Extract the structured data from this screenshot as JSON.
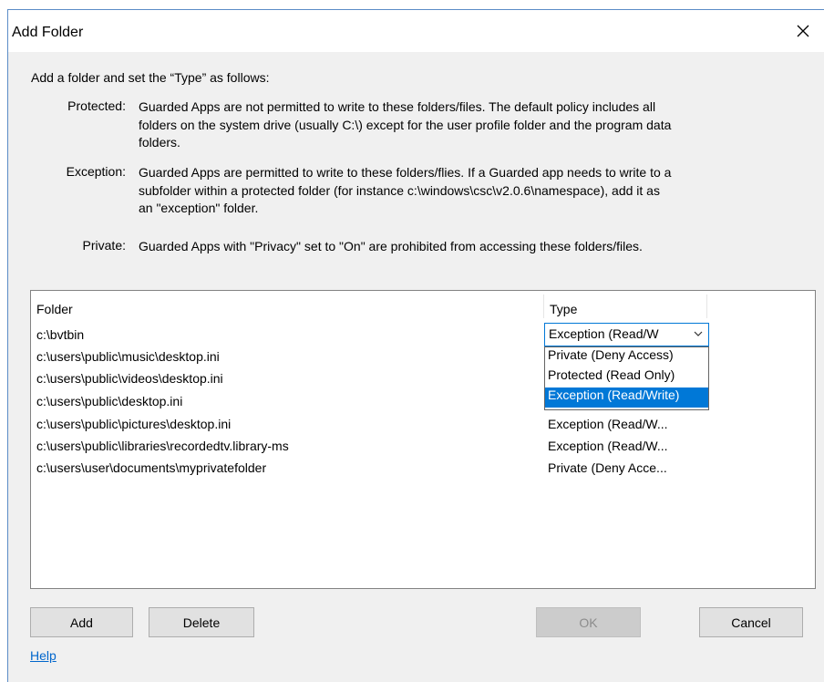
{
  "window": {
    "title": "Add Folder"
  },
  "intro": "Add a folder and set the “Type” as follows:",
  "definitions": [
    {
      "term": "Protected:",
      "lines": [
        "Guarded Apps are not permitted to write to these folders/files. The default policy includes all",
        "folders on the system drive (usually C:\\) except for the user profile folder and the program data",
        "folders."
      ]
    },
    {
      "term": "Exception:",
      "lines": [
        "Guarded Apps are permitted to write to these folders/flies. If a Guarded app needs to write to a",
        "subfolder within a protected folder (for instance c:\\windows\\csc\\v2.0.6\\namespace), add it as",
        "an \"exception\" folder."
      ]
    },
    {
      "term": "Private:",
      "lines": [
        "Guarded Apps with \"Privacy\" set to \"On\" are prohibited from accessing these folders/files."
      ]
    }
  ],
  "table": {
    "columns": [
      "Folder",
      "Type"
    ],
    "rows": [
      {
        "folder": "c:\\bvtbin",
        "type": "Exception (Read/W"
      },
      {
        "folder": "c:\\users\\public\\music\\desktop.ini",
        "type": ""
      },
      {
        "folder": "c:\\users\\public\\videos\\desktop.ini",
        "type": ""
      },
      {
        "folder": "c:\\users\\public\\desktop.ini",
        "type": "Exception (Read/W..."
      },
      {
        "folder": "c:\\users\\public\\pictures\\desktop.ini",
        "type": "Exception (Read/W..."
      },
      {
        "folder": "c:\\users\\public\\libraries\\recordedtv.library-ms",
        "type": "Exception (Read/W..."
      },
      {
        "folder": "c:\\users\\user\\documents\\myprivatefolder",
        "type": "Private (Deny Acce..."
      }
    ]
  },
  "type_dropdown": {
    "selected": "Exception (Read/W",
    "options": [
      "Private (Deny Access)",
      "Protected (Read Only)",
      "Exception (Read/Write)"
    ],
    "highlighted_index": 2
  },
  "buttons": {
    "add": "Add",
    "delete": "Delete",
    "ok": "OK",
    "cancel": "Cancel"
  },
  "help_link": "Help",
  "icons": {
    "close": "close-icon",
    "chevron": "chevron-down-icon"
  },
  "colors": {
    "accent": "#0078d7",
    "link": "#0066cc",
    "dialog_bg": "#f0f0f0"
  }
}
